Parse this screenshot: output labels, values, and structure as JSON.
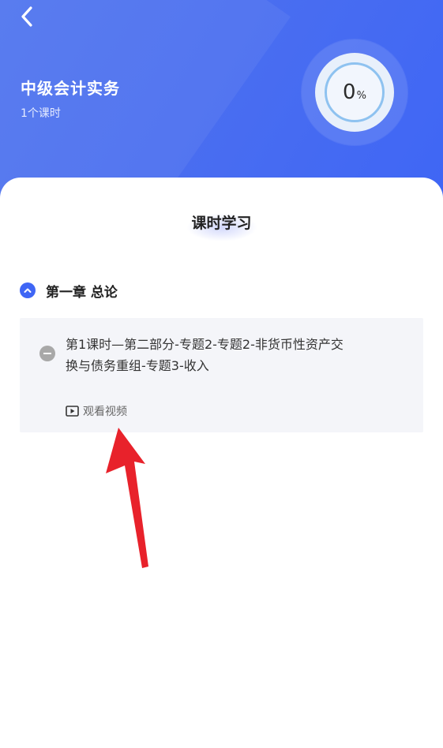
{
  "header": {
    "course_title": "中级会计实务",
    "lesson_count": "1个课时",
    "progress_value": "0",
    "progress_unit": "%"
  },
  "section": {
    "title": "课时学习"
  },
  "chapter": {
    "label": "第一章 总论",
    "expanded": true
  },
  "lesson": {
    "title": "第1课时—第二部分-专题2-专题2-非货币性资产交换与债务重组-专题3-收入",
    "watch_label": "观看视频"
  },
  "colors": {
    "brand_blue": "#3f66f5",
    "annotation_red": "#e8222b"
  }
}
